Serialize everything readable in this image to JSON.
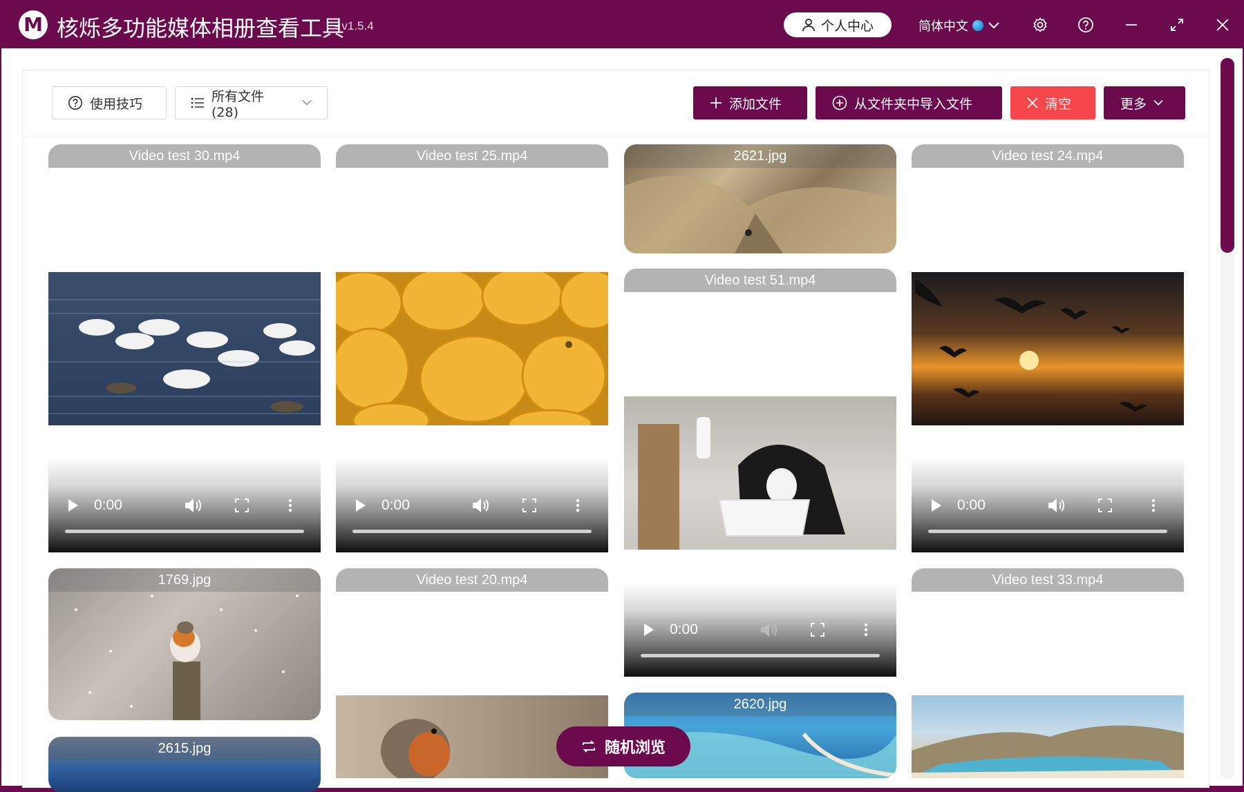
{
  "titlebar": {
    "logo_letter": "M",
    "title": "核烁多功能媒体相册查看工具",
    "version": "- v1.5.4",
    "user_center": "个人中心",
    "language": "简体中文",
    "icons": [
      "gear-icon",
      "help-icon",
      "minimize-icon",
      "maximize-icon",
      "close-icon"
    ]
  },
  "toolbar": {
    "tips_label": "使用技巧",
    "filter_label": "所有文件 (28)",
    "add_file_label": "添加文件",
    "import_folder_label": "从文件夹中导入文件",
    "clear_label": "清空",
    "more_label": "更多"
  },
  "gallery": {
    "video_time": "0:00",
    "items": [
      {
        "name": "Video test 30.mp4",
        "type": "video"
      },
      {
        "name": "Video test 25.mp4",
        "type": "video"
      },
      {
        "name": "2621.jpg",
        "type": "image"
      },
      {
        "name": "Video test 24.mp4",
        "type": "video"
      },
      {
        "name": "Video test 51.mp4",
        "type": "video"
      },
      {
        "name": "1769.jpg",
        "type": "image"
      },
      {
        "name": "Video test 20.mp4",
        "type": "video"
      },
      {
        "name": "Video test 33.mp4",
        "type": "video"
      },
      {
        "name": "2620.jpg",
        "type": "image"
      },
      {
        "name": "2615.jpg",
        "type": "image"
      }
    ]
  },
  "random_browse_label": "随机浏览",
  "colors": {
    "accent": "#6b0a4c",
    "danger": "#f5474b",
    "label_gray": "#b3b3b3"
  }
}
